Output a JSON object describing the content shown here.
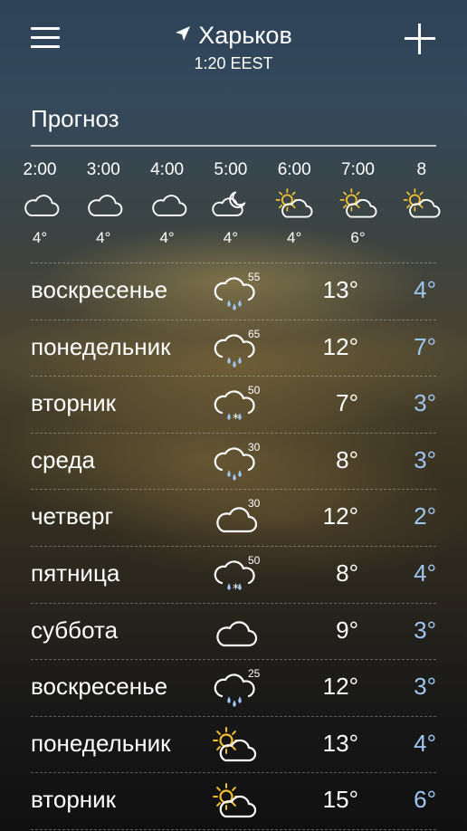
{
  "header": {
    "city": "Харьков",
    "time": "1:20 EEST"
  },
  "forecast": {
    "title": "Прогноз",
    "hourly": [
      {
        "time": "2:00",
        "icon": "cloud-icon",
        "temp": "4°"
      },
      {
        "time": "3:00",
        "icon": "cloud-icon",
        "temp": "4°"
      },
      {
        "time": "4:00",
        "icon": "cloud-icon",
        "temp": "4°"
      },
      {
        "time": "5:00",
        "icon": "cloud-moon-icon",
        "temp": "4°"
      },
      {
        "time": "6:00",
        "icon": "sun-cloud-icon",
        "temp": "4°"
      },
      {
        "time": "7:00",
        "icon": "sun-cloud-icon",
        "temp": "6°"
      },
      {
        "time": "8",
        "icon": "sun-cloud-icon",
        "temp": ""
      }
    ],
    "daily": [
      {
        "day": "воскресенье",
        "icon": "rain-icon",
        "prob": "55",
        "hi": "13°",
        "lo": "4°"
      },
      {
        "day": "понедельник",
        "icon": "rain-icon",
        "prob": "65",
        "hi": "12°",
        "lo": "7°"
      },
      {
        "day": "вторник",
        "icon": "sleet-icon",
        "prob": "50",
        "hi": "7°",
        "lo": "3°"
      },
      {
        "day": "среда",
        "icon": "rain-icon",
        "prob": "30",
        "hi": "8°",
        "lo": "3°"
      },
      {
        "day": "четверг",
        "icon": "cloud-icon",
        "prob": "30",
        "hi": "12°",
        "lo": "2°"
      },
      {
        "day": "пятница",
        "icon": "sleet-icon",
        "prob": "50",
        "hi": "8°",
        "lo": "4°"
      },
      {
        "day": "суббота",
        "icon": "cloud-icon",
        "prob": "",
        "hi": "9°",
        "lo": "3°"
      },
      {
        "day": "воскресенье",
        "icon": "rain-icon",
        "prob": "25",
        "hi": "12°",
        "lo": "3°"
      },
      {
        "day": "понедельник",
        "icon": "sun-cloud-icon",
        "prob": "",
        "hi": "13°",
        "lo": "4°"
      },
      {
        "day": "вторник",
        "icon": "sun-cloud-icon",
        "prob": "",
        "hi": "15°",
        "lo": "6°"
      }
    ]
  },
  "colors": {
    "sun": "#f2c230",
    "low_temp": "#9ec6f2",
    "text": "#ffffff"
  }
}
